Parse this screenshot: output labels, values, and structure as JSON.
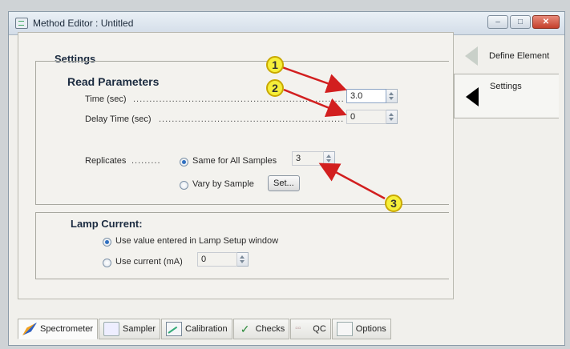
{
  "window": {
    "title": "Method Editor : Untitled",
    "buttons": {
      "minimize": "–",
      "maximize": "□",
      "close": "✕"
    }
  },
  "settings": {
    "heading": "Settings",
    "read_parameters": {
      "heading": "Read Parameters",
      "time_label": "Time (sec)",
      "time_dots": "..........................................................................",
      "time_value": "3.0",
      "delay_label": "Delay Time (sec)",
      "delay_dots": "...................................................................",
      "delay_value": "0",
      "replicates_label": "Replicates",
      "replicates_dots": ".........",
      "same_label": "Same for All Samples",
      "same_value": "3",
      "vary_label": "Vary by Sample",
      "set_button": "Set..."
    },
    "lamp_current": {
      "heading": "Lamp Current:",
      "use_value_label": "Use value entered in Lamp Setup window",
      "use_current_label": "Use current (mA)",
      "current_value": "0"
    }
  },
  "side_tabs": [
    {
      "label": "Define Element",
      "active": false
    },
    {
      "label": "Settings",
      "active": true
    }
  ],
  "bottom_tabs": [
    {
      "label": "Spectrometer",
      "icon": "spectrometer-icon"
    },
    {
      "label": "Sampler",
      "icon": "sampler-icon"
    },
    {
      "label": "Calibration",
      "icon": "calibration-icon"
    },
    {
      "label": "Checks",
      "icon": "checkmark-icon"
    },
    {
      "label": "QC",
      "icon": "qc-icon"
    },
    {
      "label": "Options",
      "icon": "options-icon"
    }
  ],
  "annotations": [
    "1",
    "2",
    "3"
  ],
  "colors": {
    "annotation_fill": "#f6ef3a",
    "arrow": "#d21f1f",
    "accent": "#2f6fc0"
  }
}
